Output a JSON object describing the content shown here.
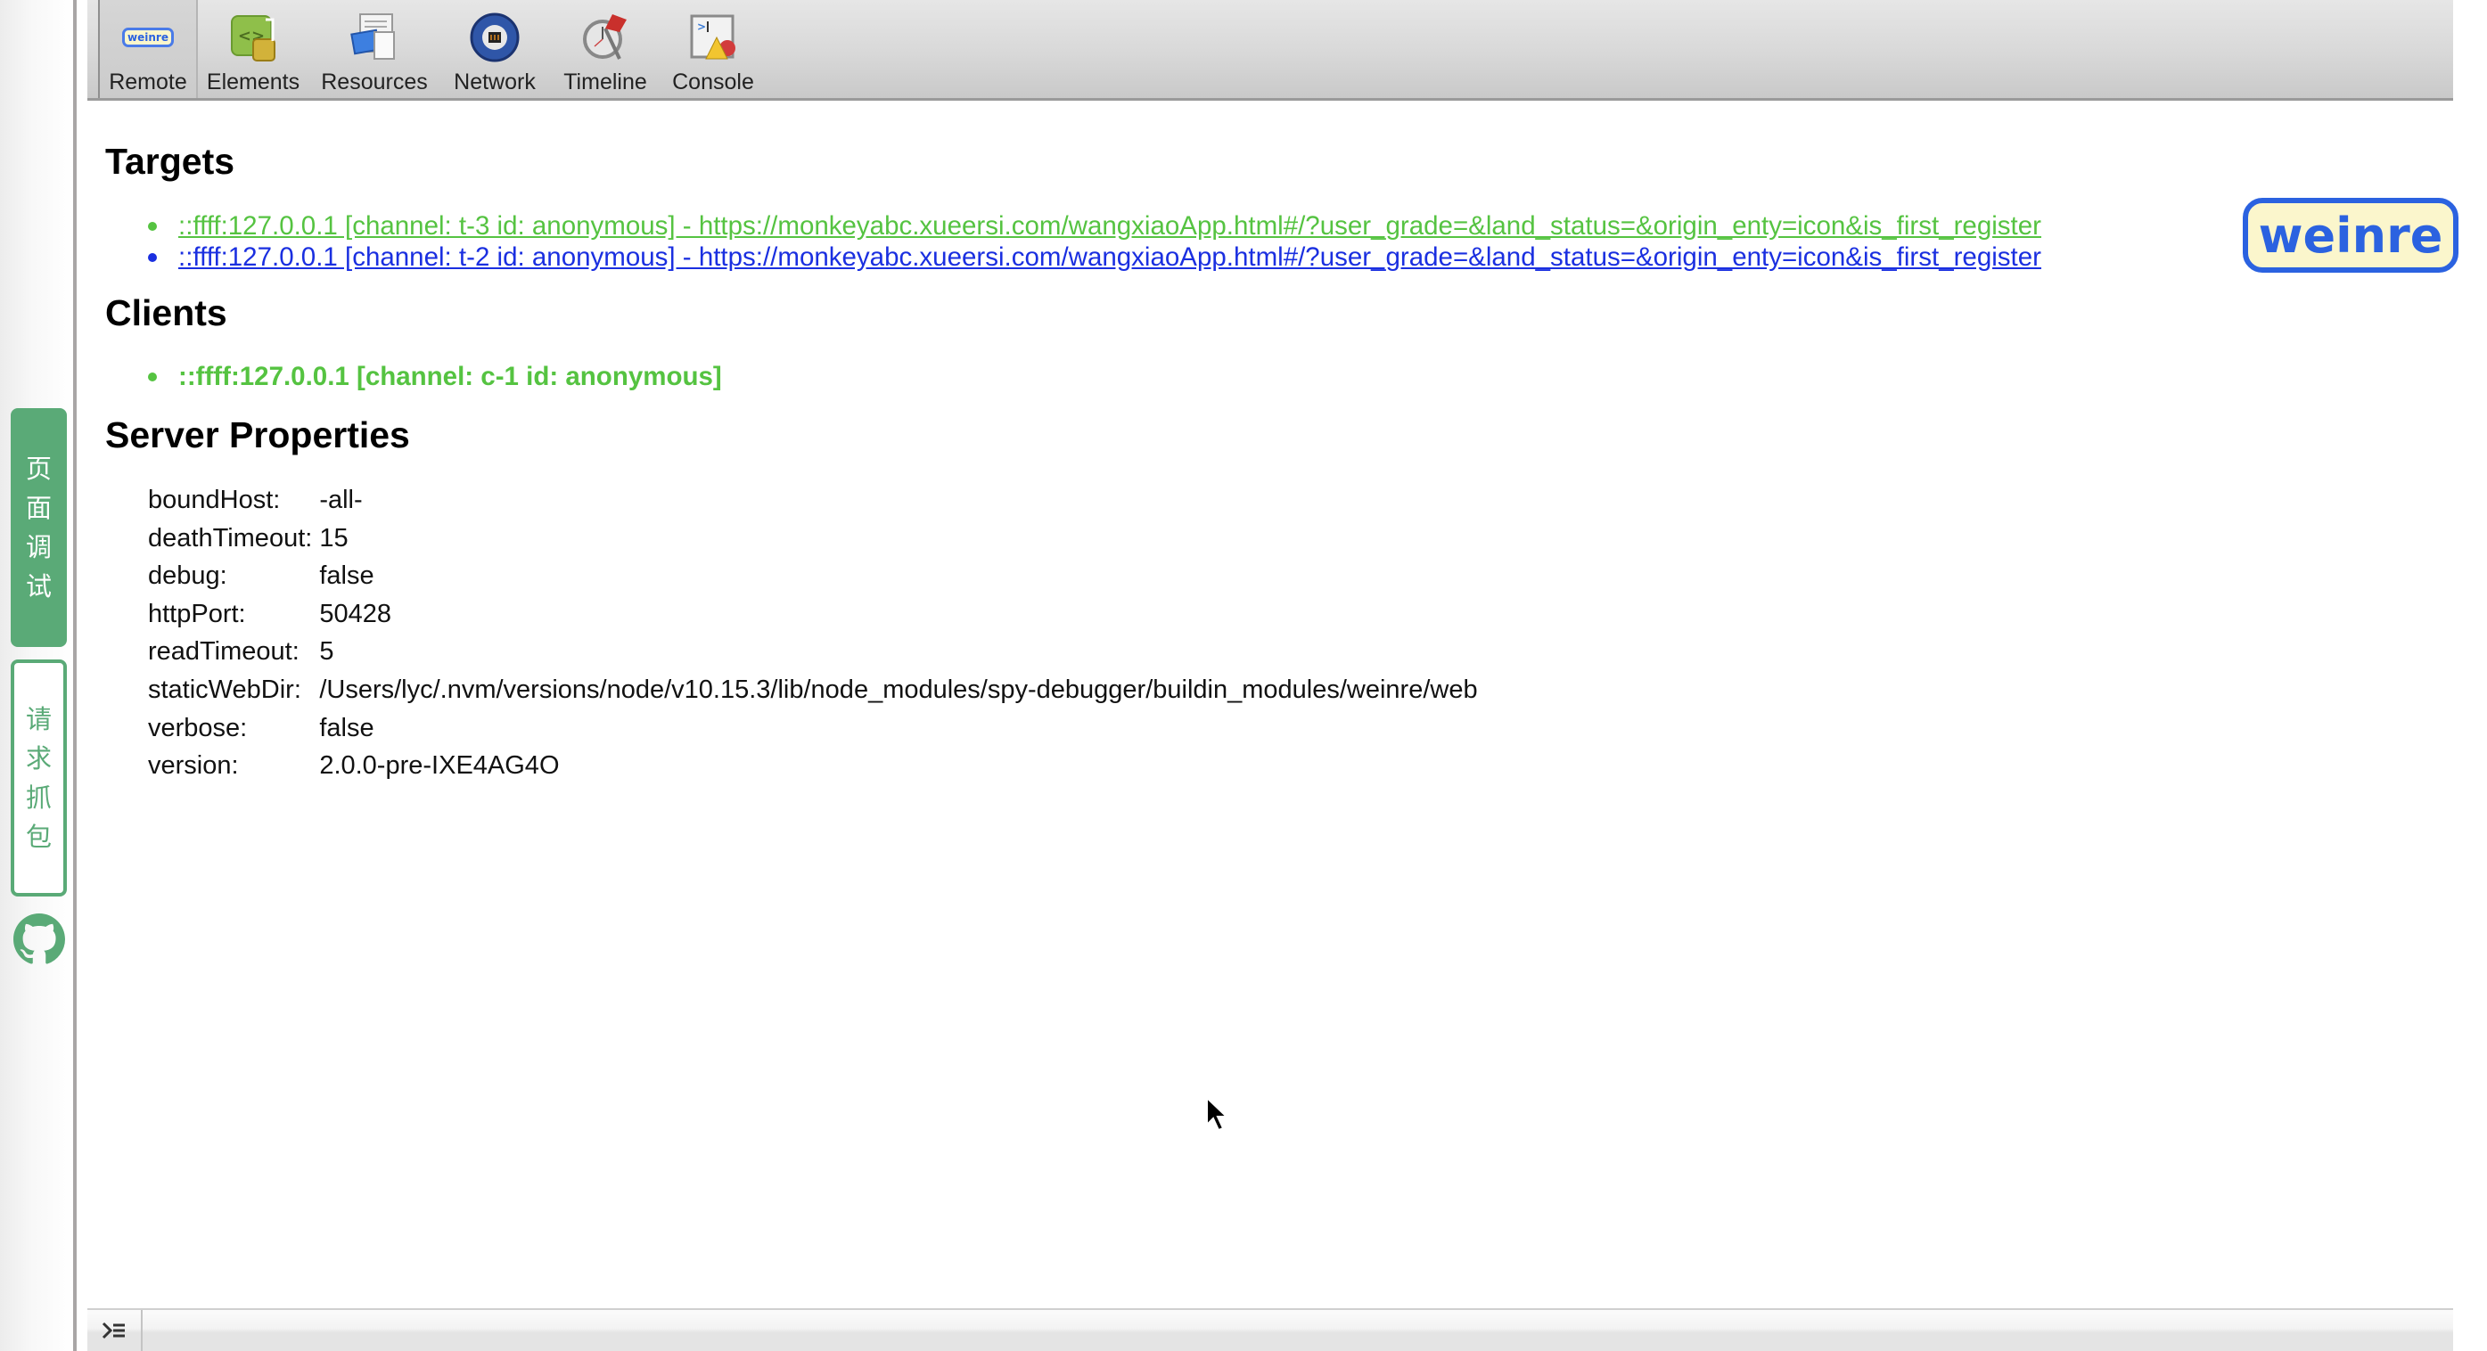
{
  "sidebar": {
    "buttons": [
      {
        "label_chars": [
          "页",
          "面",
          "调",
          "试"
        ],
        "active": true
      },
      {
        "label_chars": [
          "请",
          "求",
          "抓",
          "包"
        ],
        "active": false
      }
    ],
    "github_icon": "github-icon"
  },
  "toolbar": {
    "tabs": [
      {
        "label": "Remote",
        "icon": "weinre-icon",
        "selected": true
      },
      {
        "label": "Elements",
        "icon": "elements-icon",
        "selected": false
      },
      {
        "label": "Resources",
        "icon": "resources-icon",
        "selected": false
      },
      {
        "label": "Network",
        "icon": "network-icon",
        "selected": false
      },
      {
        "label": "Timeline",
        "icon": "timeline-icon",
        "selected": false
      },
      {
        "label": "Console",
        "icon": "console-icon",
        "selected": false
      }
    ],
    "remote_icon_text": "weinre"
  },
  "logo": {
    "text": "weinre"
  },
  "targets": {
    "heading": "Targets",
    "items": [
      {
        "text": "::ffff:127.0.0.1 [channel: t-3 id: anonymous] - https://monkeyabc.xueersi.com/wangxiaoApp.html#/?user_grade=&land_status=&origin_enty=icon&is_first_register",
        "state": "connected",
        "color": "#55c341"
      },
      {
        "text": "::ffff:127.0.0.1 [channel: t-2 id: anonymous] - https://monkeyabc.xueersi.com/wangxiaoApp.html#/?user_grade=&land_status=&origin_enty=icon&is_first_register",
        "state": "available",
        "color": "#1a2fe0"
      }
    ]
  },
  "clients": {
    "heading": "Clients",
    "items": [
      {
        "text": "::ffff:127.0.0.1 [channel: c-1 id: anonymous]",
        "color": "#55c341"
      }
    ]
  },
  "server_properties": {
    "heading": "Server Properties",
    "rows": [
      {
        "key": "boundHost:",
        "value": "-all-"
      },
      {
        "key": "deathTimeout:",
        "value": "15"
      },
      {
        "key": "debug:",
        "value": "false"
      },
      {
        "key": "httpPort:",
        "value": "50428"
      },
      {
        "key": "readTimeout:",
        "value": "5"
      },
      {
        "key": "staticWebDir:",
        "value": "/Users/lyc/.nvm/versions/node/v10.15.3/lib/node_modules/spy-debugger/buildin_modules/weinre/web"
      },
      {
        "key": "verbose:",
        "value": "false"
      },
      {
        "key": "version:",
        "value": "2.0.0-pre-IXE4AG4O"
      }
    ]
  },
  "statusbar": {
    "console_toggle_icon": "console-drawer-icon"
  },
  "colors": {
    "accent_green": "#5aaa77",
    "connected_green": "#55c341",
    "link_blue": "#1a2fe0",
    "logo_blue": "#2b62e0",
    "logo_bg": "#fbf6cc"
  }
}
